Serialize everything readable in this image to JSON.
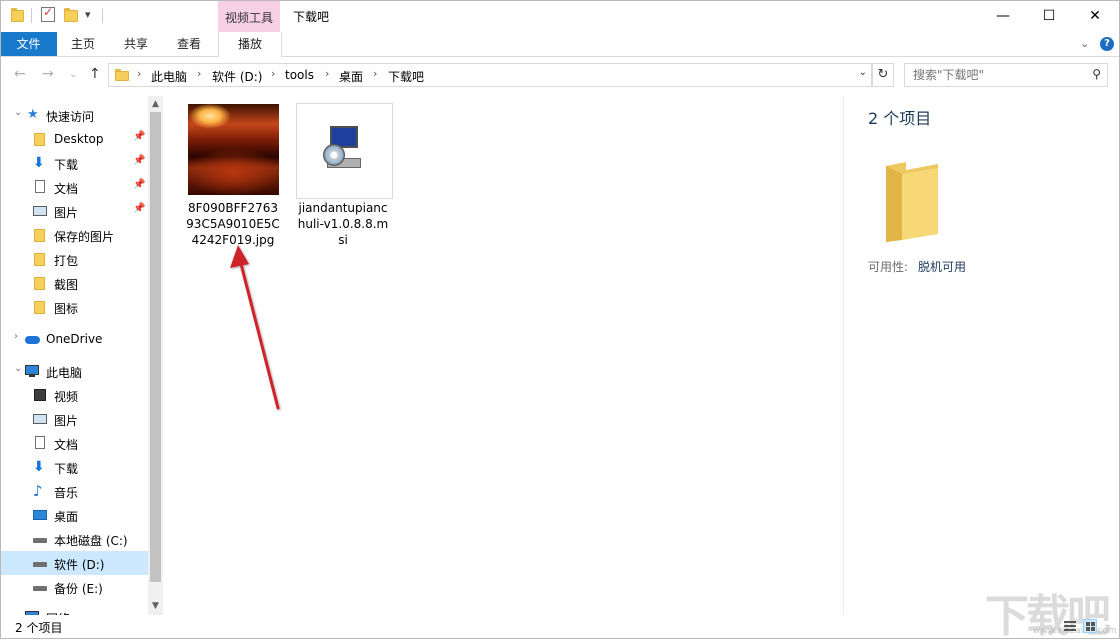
{
  "window": {
    "title": "下载吧",
    "context_tab_group": "视频工具",
    "controls": {
      "minimize": "—",
      "maximize": "☐",
      "close": "✕"
    }
  },
  "ribbon": {
    "tabs": [
      {
        "label": "文件",
        "active": true
      },
      {
        "label": "主页"
      },
      {
        "label": "共享"
      },
      {
        "label": "查看"
      },
      {
        "label": "播放",
        "contextual": true
      }
    ]
  },
  "address": {
    "breadcrumbs": [
      "此电脑",
      "软件 (D:)",
      "tools",
      "桌面",
      "下载吧"
    ]
  },
  "search": {
    "placeholder": "搜索\"下载吧\""
  },
  "sidebar": {
    "quick_access": "快速访问",
    "quick_items": [
      {
        "label": "Desktop",
        "icon": "folder-icon",
        "pinned": true
      },
      {
        "label": "下载",
        "icon": "download-arrow-icon",
        "pinned": true
      },
      {
        "label": "文档",
        "icon": "document-icon",
        "pinned": true
      },
      {
        "label": "图片",
        "icon": "pictures-icon",
        "pinned": true
      },
      {
        "label": "保存的图片",
        "icon": "folder-icon"
      },
      {
        "label": "打包",
        "icon": "folder-icon"
      },
      {
        "label": "截图",
        "icon": "folder-icon"
      },
      {
        "label": "图标",
        "icon": "folder-icon"
      }
    ],
    "onedrive": "OneDrive",
    "this_pc": "此电脑",
    "pc_items": [
      {
        "label": "视频",
        "icon": "video-icon"
      },
      {
        "label": "图片",
        "icon": "pictures-icon"
      },
      {
        "label": "文档",
        "icon": "document-icon"
      },
      {
        "label": "下载",
        "icon": "download-arrow-icon"
      },
      {
        "label": "音乐",
        "icon": "music-icon"
      },
      {
        "label": "桌面",
        "icon": "desktop-icon"
      },
      {
        "label": "本地磁盘 (C:)",
        "icon": "drive-icon"
      },
      {
        "label": "软件 (D:)",
        "icon": "drive-icon",
        "selected": true
      },
      {
        "label": "备份 (E:)",
        "icon": "drive-icon"
      },
      {
        "label": "网络",
        "icon": "network-icon"
      }
    ]
  },
  "files": [
    {
      "name": "8F090BFF276393C5A9010E5C4242F019.jpg",
      "type": "image"
    },
    {
      "name": "jiandantupianchuli-v1.0.8.8.msi",
      "type": "installer"
    }
  ],
  "details": {
    "count": "2 个项目",
    "availability_label": "可用性:",
    "availability_value": "脱机可用"
  },
  "status": {
    "count": "2 个项目"
  },
  "watermark": {
    "text": "下载吧",
    "sub": "www.xiazaiba.com"
  },
  "colors": {
    "accent": "#1979ca",
    "context_tab": "#f7d0e6",
    "selection": "#cce8ff",
    "arrow": "#d0232a"
  }
}
